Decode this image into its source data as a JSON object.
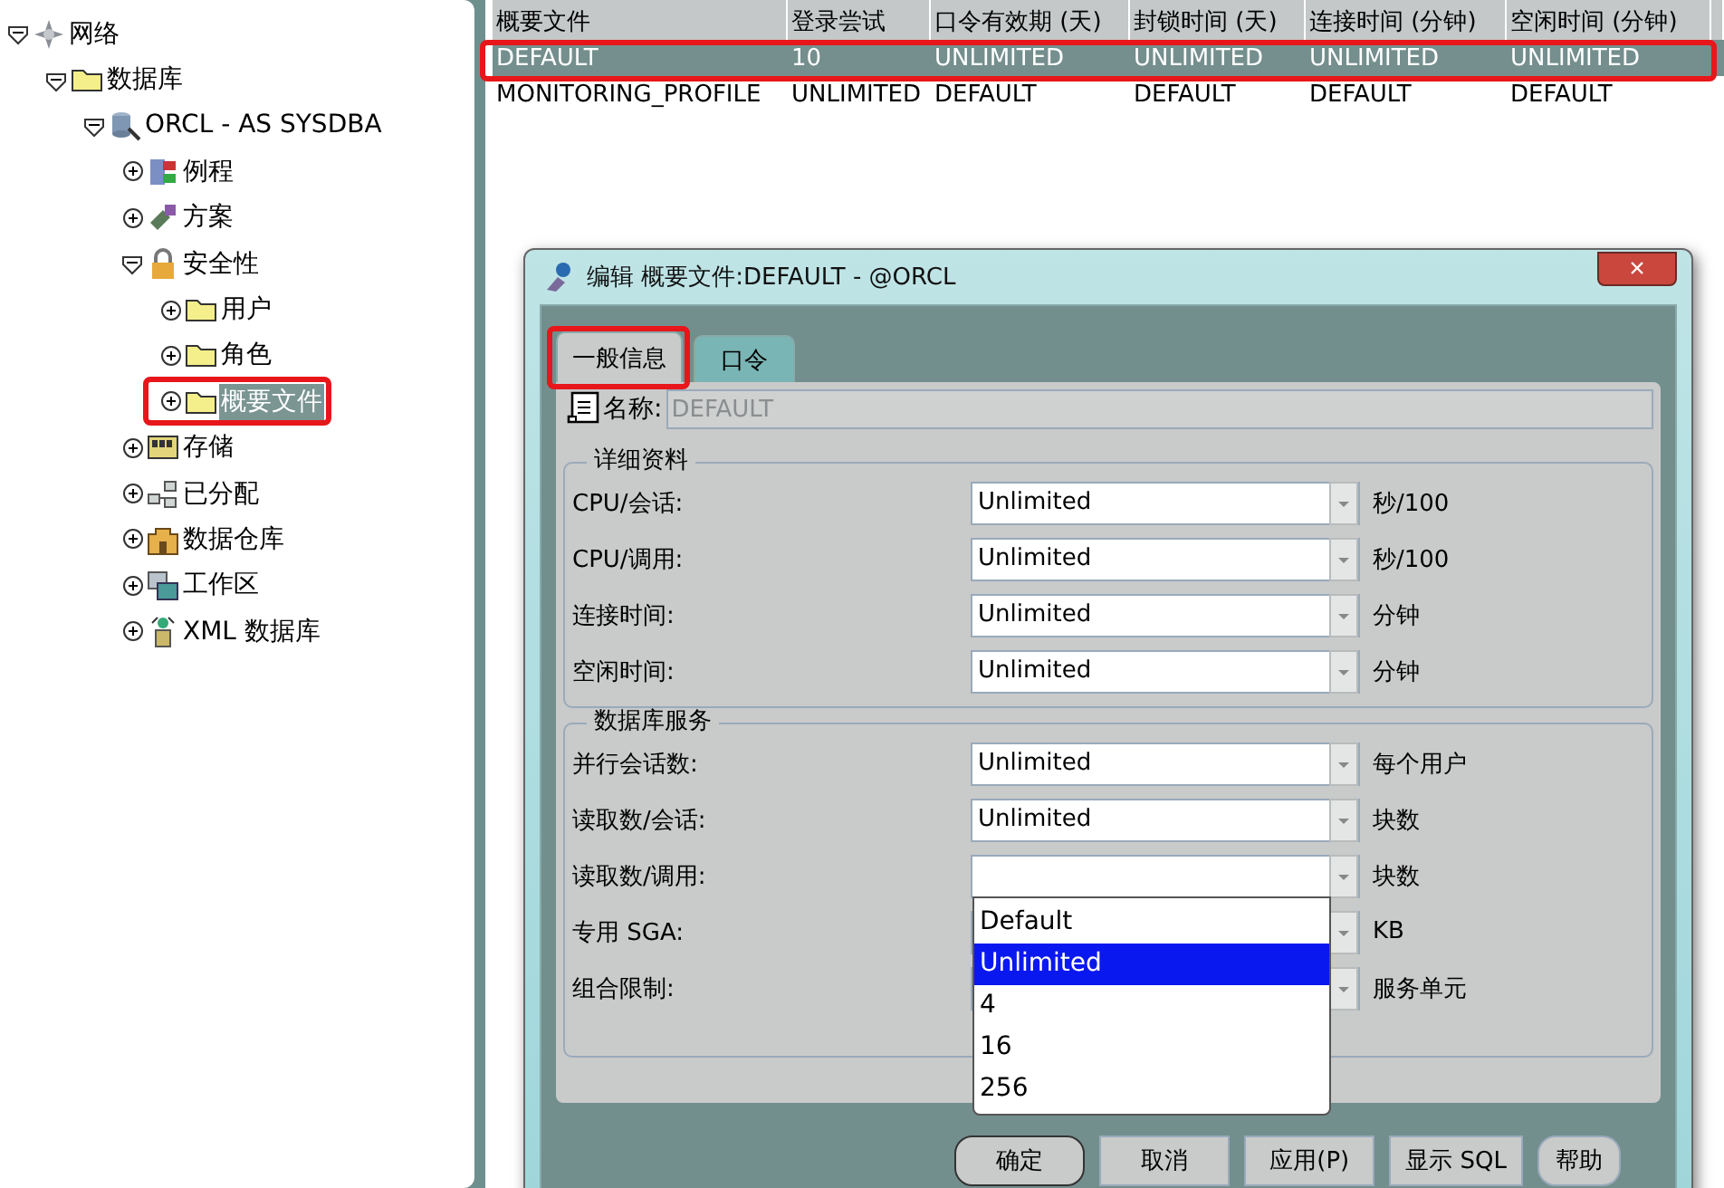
{
  "tree": [
    {
      "label": "网络",
      "kind": "network",
      "expanded": true,
      "selected": false,
      "children": [
        {
          "label": "数据库",
          "kind": "folder",
          "expanded": true,
          "selected": false,
          "children": [
            {
              "label": "ORCL -  AS SYSDBA",
              "kind": "database",
              "expanded": true,
              "selected": false,
              "children": [
                {
                  "label": "例程",
                  "kind": "routine",
                  "expanded": false,
                  "selected": false
                },
                {
                  "label": "方案",
                  "kind": "schema",
                  "expanded": false,
                  "selected": false
                },
                {
                  "label": "安全性",
                  "kind": "lock",
                  "expanded": true,
                  "selected": false,
                  "children": [
                    {
                      "label": "用户",
                      "kind": "folder",
                      "expanded": false,
                      "selected": false
                    },
                    {
                      "label": "角色",
                      "kind": "folder",
                      "expanded": false,
                      "selected": false
                    },
                    {
                      "label": "概要文件",
                      "kind": "folder",
                      "expanded": false,
                      "selected": true,
                      "highlighted": true
                    }
                  ]
                },
                {
                  "label": "存储",
                  "kind": "storage",
                  "expanded": false,
                  "selected": false
                },
                {
                  "label": "已分配",
                  "kind": "nodes",
                  "expanded": false,
                  "selected": false
                },
                {
                  "label": "数据仓库",
                  "kind": "warehouse",
                  "expanded": false,
                  "selected": false
                },
                {
                  "label": "工作区",
                  "kind": "workspace",
                  "expanded": false,
                  "selected": false
                },
                {
                  "label": "XML 数据库",
                  "kind": "xml",
                  "expanded": false,
                  "selected": false
                }
              ]
            }
          ]
        }
      ]
    }
  ],
  "table": {
    "columns": [
      "概要文件",
      "登录尝试",
      "口令有效期 (天)",
      "封锁时间 (天)",
      "连接时间 (分钟)",
      "空闲时间 (分钟)"
    ],
    "rows": [
      {
        "cells": [
          "DEFAULT",
          "10",
          "UNLIMITED",
          "UNLIMITED",
          "UNLIMITED",
          "UNLIMITED"
        ],
        "selected": true,
        "highlighted": true
      },
      {
        "cells": [
          "MONITORING_PROFILE",
          "UNLIMITED",
          "DEFAULT",
          "DEFAULT",
          "DEFAULT",
          "DEFAULT"
        ],
        "selected": false
      }
    ]
  },
  "dialog": {
    "title": "编辑 概要文件:DEFAULT - @ORCL",
    "close": "×",
    "tabs": [
      {
        "label": "一般信息",
        "selected": true,
        "highlighted": true
      },
      {
        "label": "口令",
        "selected": false
      }
    ],
    "name_label": "名称:",
    "name_value": "DEFAULT",
    "groups": [
      {
        "title": "详细资料",
        "rows": [
          {
            "label": "CPU/会话:",
            "value": "Unlimited",
            "unit": "秒/100"
          },
          {
            "label": "CPU/调用:",
            "value": "Unlimited",
            "unit": "秒/100"
          },
          {
            "label": "连接时间:",
            "value": "Unlimited",
            "unit": "分钟"
          },
          {
            "label": "空闲时间:",
            "value": "Unlimited",
            "unit": "分钟"
          }
        ]
      },
      {
        "title": "数据库服务",
        "rows": [
          {
            "label": "并行会话数:",
            "value": "Unlimited",
            "unit": "每个用户"
          },
          {
            "label": "读取数/会话:",
            "value": "Unlimited",
            "unit": "块数"
          },
          {
            "label": "读取数/调用:",
            "unit": "块数",
            "open": true
          },
          {
            "label": "专用 SGA:",
            "unit": "KB"
          },
          {
            "label": "组合限制:",
            "unit": "服务单元"
          }
        ]
      }
    ],
    "dropdown_options": [
      {
        "label": "Default",
        "selected": false
      },
      {
        "label": "Unlimited",
        "selected": true
      },
      {
        "label": "4",
        "selected": false
      },
      {
        "label": "16",
        "selected": false
      },
      {
        "label": "256",
        "selected": false
      }
    ],
    "buttons": [
      {
        "label": "确定",
        "kind": "default"
      },
      {
        "label": "取消",
        "kind": "normal"
      },
      {
        "label": "应用(P)",
        "kind": "normal"
      },
      {
        "label": "显示 SQL",
        "kind": "normal"
      },
      {
        "label": "帮助",
        "kind": "rounded"
      }
    ]
  }
}
